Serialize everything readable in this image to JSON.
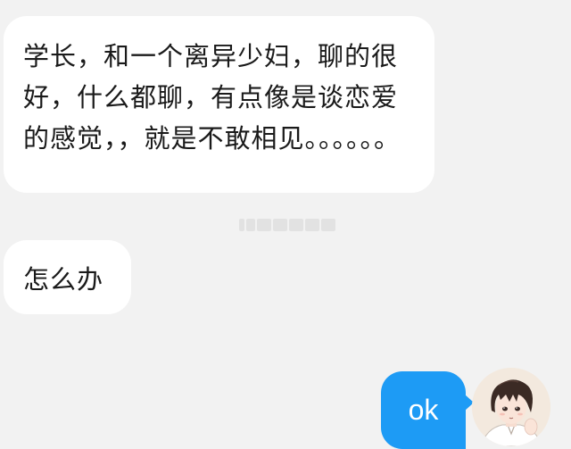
{
  "messages": [
    {
      "direction": "incoming",
      "text": "学长，和一个离异少妇，聊的很好，什么都聊，有点像是谈恋爱的感觉，，就是不敢相见。。。。。。"
    },
    {
      "direction": "incoming",
      "text": "怎么办"
    },
    {
      "direction": "outgoing",
      "text": "ok"
    }
  ],
  "colors": {
    "background": "#f2f2f2",
    "incoming_bubble": "#ffffff",
    "outgoing_bubble": "#1d9bf5"
  },
  "icons": {
    "avatar": "user-avatar-anime-boy"
  }
}
